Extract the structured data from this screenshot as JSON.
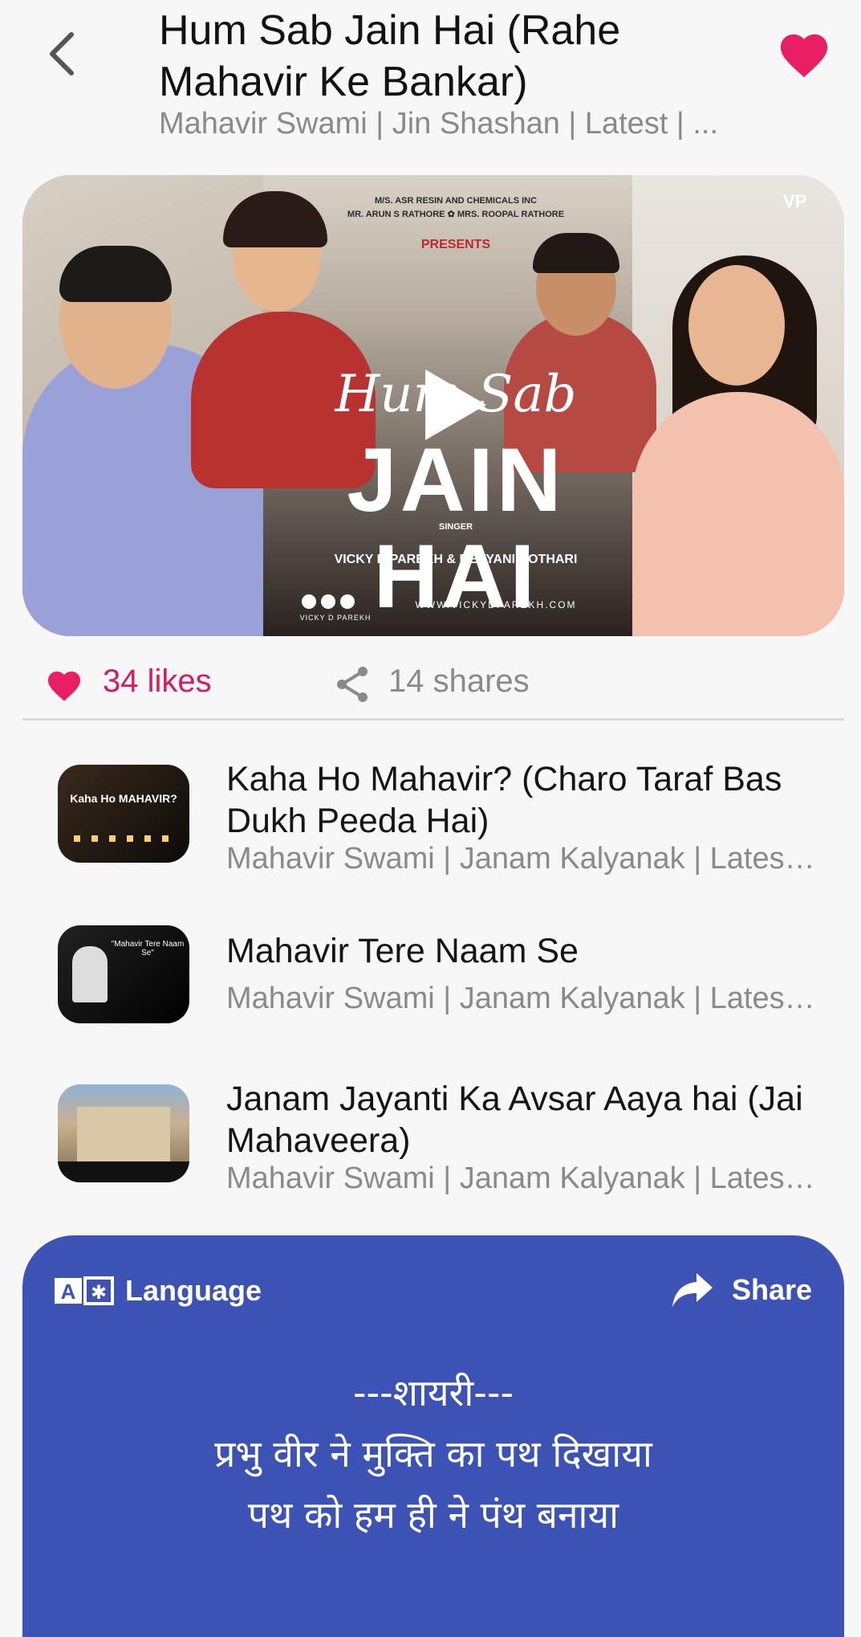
{
  "header": {
    "title": "Hum Sab Jain Hai (Rahe Mahavir Ke Bankar)",
    "subtitle": "Mahavir Swami | Jin Shashan | Latest | ...",
    "favorite_color": "#e91e63"
  },
  "video": {
    "sponsor_line1": "M/S. ASR RESIN AND CHEMICALS INC",
    "sponsor_line2": "MR. ARUN S RATHORE ✿ MRS. ROOPAL RATHORE",
    "presents": "PRESENTS",
    "title_line1": "Hum Sab",
    "title_line2": "JAIN HAI",
    "singer_label": "SINGER",
    "singers": "VICKY D PAREKH & DEVYANI KOTHARI",
    "website": "WWW.VICKYDPAREKH.COM",
    "handle": "VICKY D PAREKH",
    "logo": "VP",
    "play_icon": "play-icon"
  },
  "stats": {
    "likes": "34 likes",
    "shares": "14 shares",
    "likes_color": "#d81b60"
  },
  "related": [
    {
      "title": "Kaha Ho Mahavir? (Charo Taraf Bas Dukh Peeda Hai)",
      "subtitle": "Mahavir Swami | Janam Kalyanak | Latest ...",
      "thumb_text": "Kaha Ho MAHAVIR?"
    },
    {
      "title": "Mahavir Tere Naam Se",
      "subtitle": "Mahavir Swami | Janam Kalyanak | Latest ...",
      "thumb_text": "\"Mahavir Tere Naam Se\""
    },
    {
      "title": "Janam Jayanti Ka Avsar Aaya hai (Jai Mahaveera)",
      "subtitle": "Mahavir Swami | Janam Kalyanak | Latest ...",
      "thumb_text": ""
    }
  ],
  "lyrics_card": {
    "language_label": "Language",
    "share_label": "Share",
    "background": "#3d52b5",
    "poem_heading": "---शायरी---",
    "poem_line1": "प्रभु वीर ने मुक्ति का पथ दिखाया",
    "poem_line2": "पथ को हम ही ने पंथ बनाया"
  }
}
